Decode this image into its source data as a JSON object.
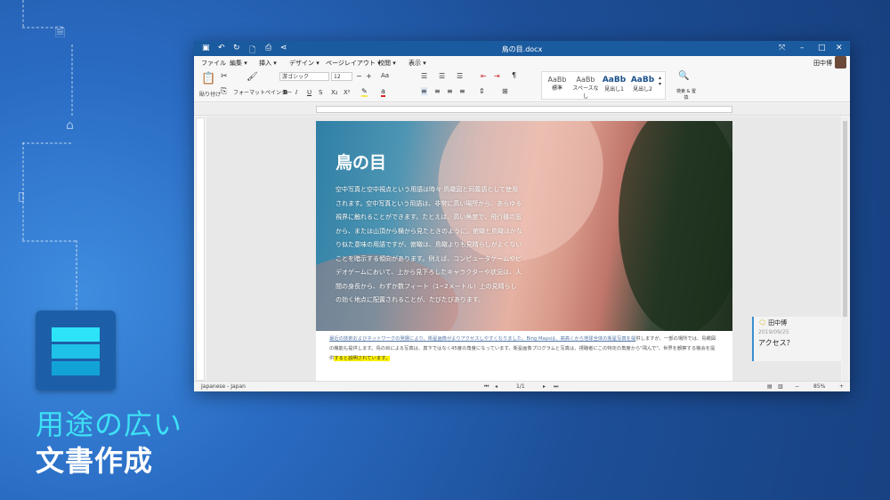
{
  "tagline": {
    "line1": "用途の広い",
    "line2": "文書作成"
  },
  "window": {
    "title": "鳥の目.docx",
    "user": "田中博"
  },
  "quick_access": [
    "save-icon",
    "undo-icon",
    "redo-icon",
    "new-document-icon",
    "print-icon",
    "share-icon"
  ],
  "menu": [
    "ファイル",
    "編集 ▾",
    "挿入 ▾",
    "デザイン ▾",
    "ページレイアウト ▾",
    "校閲 ▾",
    "表示 ▾"
  ],
  "ribbon": {
    "paste": "貼り付け",
    "format_painter": "フォーマットペインター",
    "font": "游ゴシック",
    "font_size": "12",
    "case": "Aa",
    "bold": "B",
    "italic": "I",
    "underline": "U",
    "strike": "S",
    "subscript": "X₂",
    "superscript": "X²",
    "styles": [
      {
        "sample": "AaBb",
        "name": "標準"
      },
      {
        "sample": "AaBb",
        "name": "スペースなし"
      },
      {
        "sample": "AaBb",
        "name": "見出し1"
      },
      {
        "sample": "AaBb",
        "name": "見出し2"
      }
    ],
    "find_replace": "検索 & 置換"
  },
  "document": {
    "title": "鳥の目",
    "paragraph1": "空中写真と空中視点という用語は時々 鳥瞰図と同義語として使用されます。空中写真という用語は、非常に高い場所から、あらゆる視界に触れることができます。たとえば、高い角度で、飛行機の窓から、または山頂から横から見たときのように。俯瞰と鳥瞰はかなり似た意味の用語ですが、俯瞰は、鳥瞰よりも見晴らしがよくないことを暗示する傾向があります。例えば、コンピュータゲームやビデオゲームにおいて、上から見下ろしたキャラクターや状況は、人間の身長から、わずか数フィート（1~2メートル）上の見晴らしの効く地点に配置されることが、たびたびあります。",
    "paragraph2_underlined": "最近の技術およびネットワークの発展により、衛星画像がよりアクセスしやすくなりました。Bing Mapsは、高高くから地球全体の衛星写真を提",
    "paragraph2_rest": "供しますが、一部の場所では、鳥瞰図の機能も提供します。鳥の目による写真は、真下ではなく45度の角度になっています。衛星画像プログラムと写真は、視聴者にこの特定の角度から\"飛んで\"、世界を観察する機会を提供",
    "paragraph2_highlight": "すると説明されています。"
  },
  "comment": {
    "author": "田中博",
    "date": "2019/09/25",
    "text": "アクセス？"
  },
  "status": {
    "language": "Japanese - Japan",
    "page": "1/1",
    "zoom": "85%"
  },
  "colors": {
    "titlebar": "#1a5a9e",
    "accent_text": "#3ee0f5",
    "highlight": "#fff200"
  }
}
